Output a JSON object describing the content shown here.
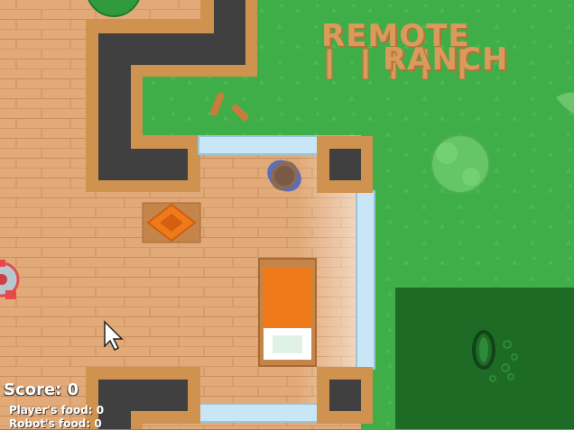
{
  "hud": {
    "score_label": "Score: 0",
    "player_food_label": "Player's food: 0",
    "robot_food_label": "Robot's food: 0"
  },
  "sign": {
    "line1": "REMOTE",
    "line2": "RANCH"
  },
  "colors": {
    "grass": "#3fae49",
    "field": "#1e6b26",
    "floor": "#e0a877",
    "wall_outline": "#d0934f",
    "wall_core": "#404040",
    "window": "#c8e6f5",
    "bed_blanket": "#ef7a1a",
    "rug": "#ef7a1a"
  },
  "icons": [
    "player-character-icon",
    "robot-icon",
    "mouse-cursor-icon",
    "rug-icon",
    "bed-icon",
    "bush-icon",
    "seedling-icon",
    "wood-sticks-icon"
  ]
}
